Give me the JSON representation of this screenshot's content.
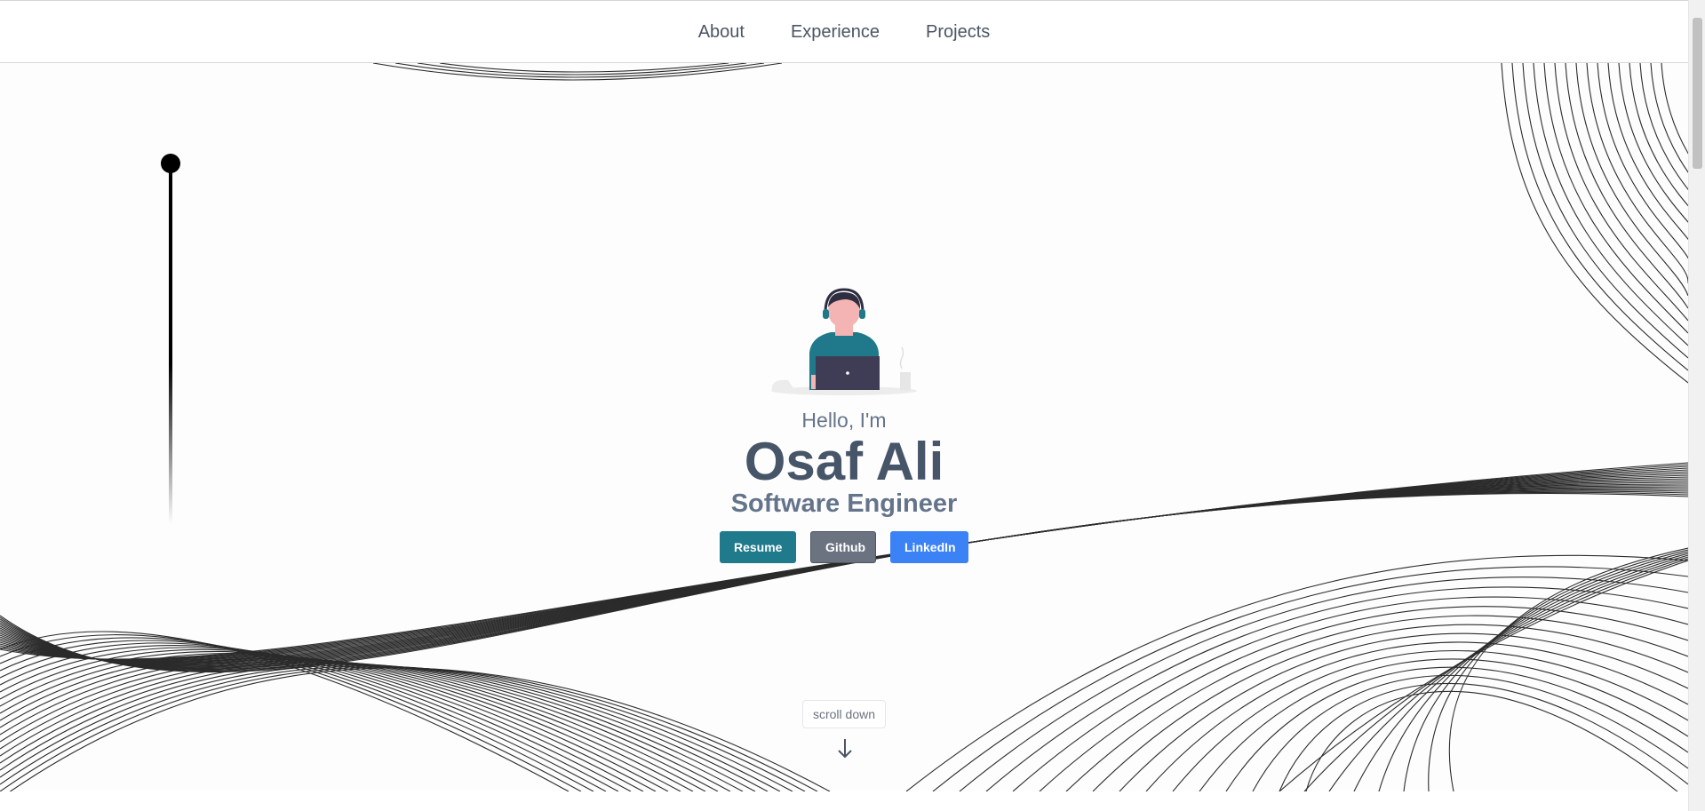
{
  "nav": {
    "items": [
      {
        "label": "About"
      },
      {
        "label": "Experience"
      },
      {
        "label": "Projects"
      }
    ]
  },
  "hero": {
    "greeting": "Hello, I'm",
    "name": "Osaf Ali",
    "role": "Software Engineer",
    "buttons": {
      "resume": "Resume",
      "github": "Github",
      "linkedin": "LinkedIn"
    }
  },
  "scroll_hint": {
    "label": "scroll down",
    "icon": "arrow-down-icon"
  },
  "colors": {
    "resume": "#1f7a8c",
    "github": "#6b7280",
    "linkedin": "#3b82f6",
    "heading": "#475569",
    "subheading": "#64748b"
  }
}
